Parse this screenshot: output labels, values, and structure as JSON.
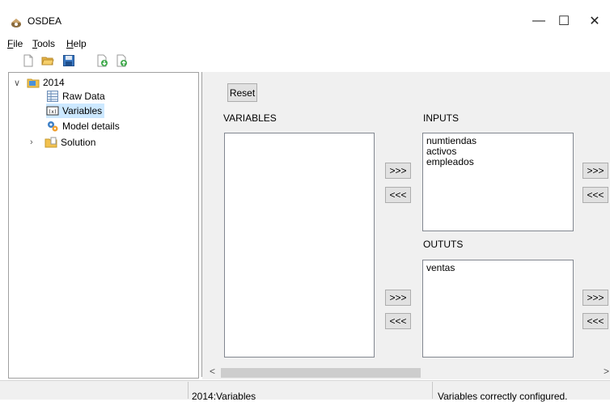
{
  "window": {
    "title": "OSDEA",
    "minimize_glyph": "—",
    "maximize_glyph": "☐",
    "close_glyph": "✕"
  },
  "menubar": {
    "items": [
      {
        "accel": "F",
        "rest": "ile"
      },
      {
        "accel": "T",
        "rest": "ools"
      },
      {
        "accel": "H",
        "rest": "elp"
      }
    ]
  },
  "toolbar": {
    "icons": [
      "new-document-icon",
      "open-folder-icon",
      "save-disk-icon",
      "import-document-icon",
      "export-document-icon"
    ]
  },
  "tree": {
    "root": {
      "label": "2014",
      "expanded": true,
      "icon": "project-folder-icon"
    },
    "children": [
      {
        "label": "Raw Data",
        "icon": "table-icon"
      },
      {
        "label": "Variables",
        "icon": "variables-icon",
        "selected": true
      },
      {
        "label": "Model details",
        "icon": "gear-icon"
      },
      {
        "label": "Solution",
        "icon": "solution-folder-icon",
        "collapsed": true
      }
    ]
  },
  "main": {
    "reset_label": "Reset",
    "variables_header": "VARIABLES",
    "inputs_header": "INPUTS",
    "outputs_header": "OUTUTS",
    "move_right_label": ">>>",
    "move_left_label": "<<<",
    "variables_items": [],
    "inputs_items": [
      "numtiendas",
      "activos",
      "empleados"
    ],
    "outputs_items": [
      "ventas"
    ]
  },
  "scroll": {
    "left_arrow": "<",
    "right_arrow": ">"
  },
  "statusbar": {
    "path": "2014:Variables",
    "message": "Variables correctly configured."
  },
  "colors": {
    "selection": "#cce8ff",
    "panel_bg": "#f0f0f0",
    "folder_yellow": "#f2c14e"
  }
}
